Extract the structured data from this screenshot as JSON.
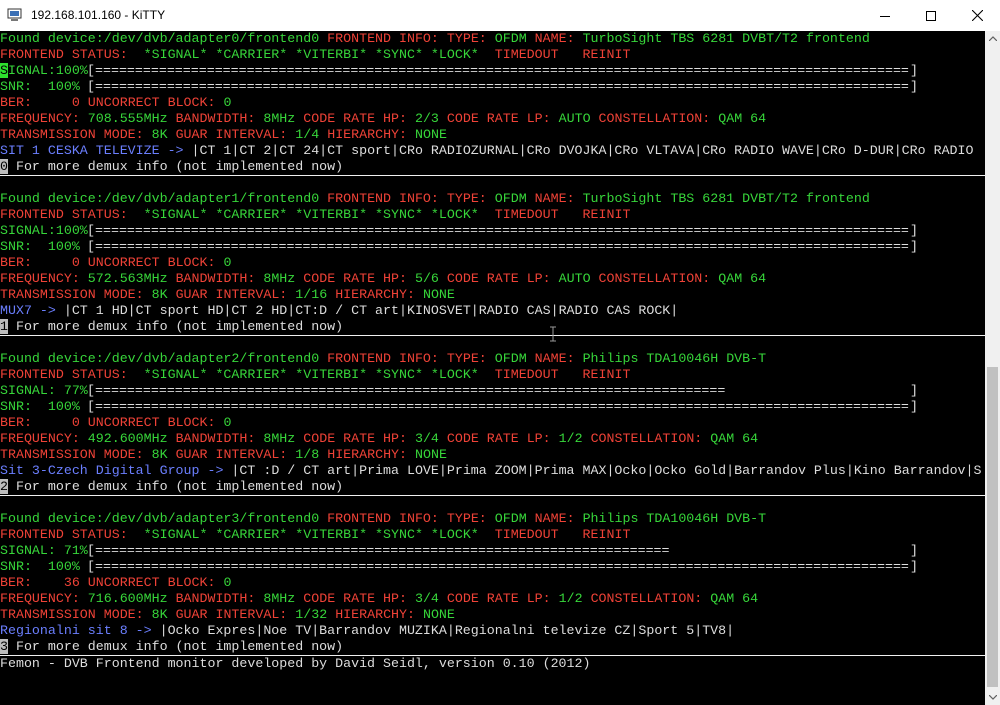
{
  "window": {
    "title": "192.168.101.160 - KiTTY",
    "icon": "computer-terminal-icon",
    "controls": [
      "minimize-icon",
      "maximize-icon",
      "close-icon"
    ]
  },
  "colors": {
    "green": "#37d63a",
    "red": "#ef4237",
    "white": "#dddddd",
    "blue": "#6b7fff"
  },
  "frontends": [
    {
      "device": "/dev/dvb/adapter0/frontend0",
      "type": "OFDM",
      "name": "TurboSight TBS 6281 DVBT/T2 frontend",
      "status_flags": "*SIGNAL* *CARRIER* *VITERBI* *SYNC* *LOCK*",
      "timedout": "TIMEDOUT",
      "reinit": "REINIT",
      "signal": "100%",
      "signal_level": 1.0,
      "snr": "100%",
      "snr_level": 1.0,
      "ber": "0",
      "uncorrect_block": "0",
      "frequency": "708.555MHz",
      "bandwidth": "8MHz",
      "code_rate_hp": "2/3",
      "code_rate_lp": "AUTO",
      "constellation": "QAM 64",
      "transmission_mode": "8K",
      "guard_interval": "1/4",
      "hierarchy": "NONE",
      "network": "SIT 1 CESKA TELEVIZE ->",
      "services": "|CT 1|CT 2|CT 24|CT sport|CRo RADIOZURNAL|CRo DVOJKA|CRo VLTAVA|CRo RADIO WAVE|CRo D-DUR|CRo RADIO",
      "demux_index": "0",
      "demux_text": " For more demux info (not implemented now)"
    },
    {
      "device": "/dev/dvb/adapter1/frontend0",
      "type": "OFDM",
      "name": "TurboSight TBS 6281 DVBT/T2 frontend",
      "status_flags": "*SIGNAL* *CARRIER* *VITERBI* *SYNC* *LOCK*",
      "timedout": "TIMEDOUT",
      "reinit": "REINIT",
      "signal": "100%",
      "signal_level": 1.0,
      "snr": "100%",
      "snr_level": 1.0,
      "ber": "0",
      "uncorrect_block": "0",
      "frequency": "572.563MHz",
      "bandwidth": "8MHz",
      "code_rate_hp": "5/6",
      "code_rate_lp": "AUTO",
      "constellation": "QAM 64",
      "transmission_mode": "8K",
      "guard_interval": "1/16",
      "hierarchy": "NONE",
      "network": "MUX7 ->",
      "services": "|CT 1 HD|CT sport HD|CT 2 HD|CT:D / CT art|KINOSVET|RADIO CAS|RADIO CAS ROCK|",
      "demux_index": "1",
      "demux_text": " For more demux info (not implemented now)"
    },
    {
      "device": "/dev/dvb/adapter2/frontend0",
      "type": "OFDM",
      "name": "Philips TDA10046H DVB-T",
      "status_flags": "*SIGNAL* *CARRIER* *VITERBI* *SYNC* *LOCK*",
      "timedout": "TIMEDOUT",
      "reinit": "REINIT",
      "signal": " 77%",
      "signal_level": 0.77,
      "snr": "100%",
      "snr_level": 1.0,
      "ber": "0",
      "uncorrect_block": "0",
      "frequency": "492.600MHz",
      "bandwidth": "8MHz",
      "code_rate_hp": "3/4",
      "code_rate_lp": "1/2",
      "constellation": "QAM 64",
      "transmission_mode": "8K",
      "guard_interval": "1/8",
      "hierarchy": "NONE",
      "network": "Sit 3-Czech Digital Group ->",
      "services": "|CT :D / CT art|Prima LOVE|Prima ZOOM|Prima MAX|Ocko|Ocko Gold|Barrandov Plus|Kino Barrandov|S",
      "demux_index": "2",
      "demux_text": " For more demux info (not implemented now)"
    },
    {
      "device": "/dev/dvb/adapter3/frontend0",
      "type": "OFDM",
      "name": "Philips TDA10046H DVB-T",
      "status_flags": "*SIGNAL* *CARRIER* *VITERBI* *SYNC* *LOCK*",
      "timedout": "TIMEDOUT",
      "reinit": "REINIT",
      "signal": " 71%",
      "signal_level": 0.71,
      "snr": "100%",
      "snr_level": 1.0,
      "ber": "36",
      "uncorrect_block": "0",
      "frequency": "716.600MHz",
      "bandwidth": "8MHz",
      "code_rate_hp": "3/4",
      "code_rate_lp": "1/2",
      "constellation": "QAM 64",
      "transmission_mode": "8K",
      "guard_interval": "1/32",
      "hierarchy": "NONE",
      "network": "Regionalni sit 8 ->",
      "services": "|Ocko Expres|Noe TV|Barrandov MUZIKA|Regionalni televize CZ|Sport 5|TV8|",
      "demux_index": "3",
      "demux_text": " For more demux info (not implemented now)"
    }
  ],
  "labels": {
    "found_device": "Found device:",
    "frontend_info": "FRONTEND INFO:",
    "type": "TYPE:",
    "name": "NAME:",
    "frontend_status": "FRONTEND STATUS:",
    "signal": "SIGNAL:",
    "snr": "SNR:",
    "ber": "BER:",
    "uncorrect_block": "UNCORRECT BLOCK:",
    "frequency": "FREQUENCY:",
    "bandwidth": "BANDWIDTH:",
    "code_rate_hp": "CODE RATE HP:",
    "code_rate_lp": "CODE RATE LP:",
    "constellation": "CONSTELLATION:",
    "transmission_mode": "TRANSMISSION MODE:",
    "guard_interval": "GUAR INTERVAL:",
    "hierarchy": "HIERARCHY:"
  },
  "footer": "Femon - DVB Frontend monitor developed by David Seidl, version 0.10 (2012)"
}
